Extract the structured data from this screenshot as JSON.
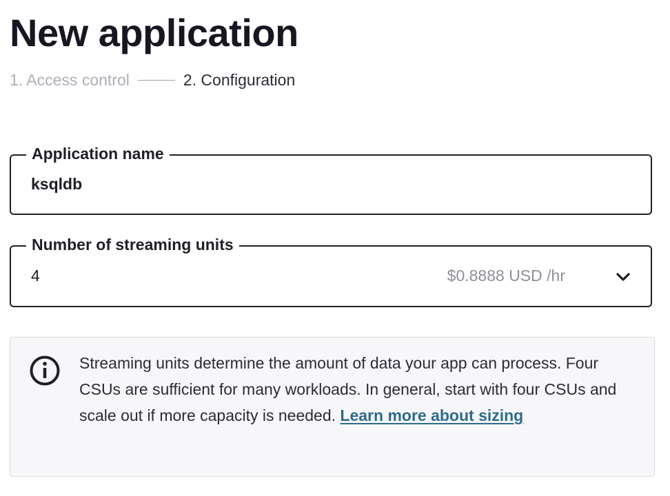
{
  "header": {
    "title": "New application"
  },
  "stepper": {
    "steps": [
      {
        "label": "1. Access control",
        "state": "inactive"
      },
      {
        "label": "2. Configuration",
        "state": "active"
      }
    ]
  },
  "form": {
    "app_name": {
      "label": "Application name",
      "value": "ksqldb"
    },
    "streaming_units": {
      "label": "Number of streaming units",
      "selected_value": "4",
      "price_hint": "$0.8888 USD /hr",
      "icon": "chevron-down-icon"
    }
  },
  "info": {
    "icon": "info-circle-icon",
    "text": "Streaming units determine the amount of data your app can process. Four CSUs are sufficient for many workloads. In general, start with four CSUs and scale out if more capacity is needed. ",
    "link_label": "Learn more about sizing"
  },
  "colors": {
    "text_primary": "#1f1f27",
    "text_muted": "#aeaeb8",
    "link": "#2e6b8a",
    "info_background": "#f7f7f9"
  }
}
